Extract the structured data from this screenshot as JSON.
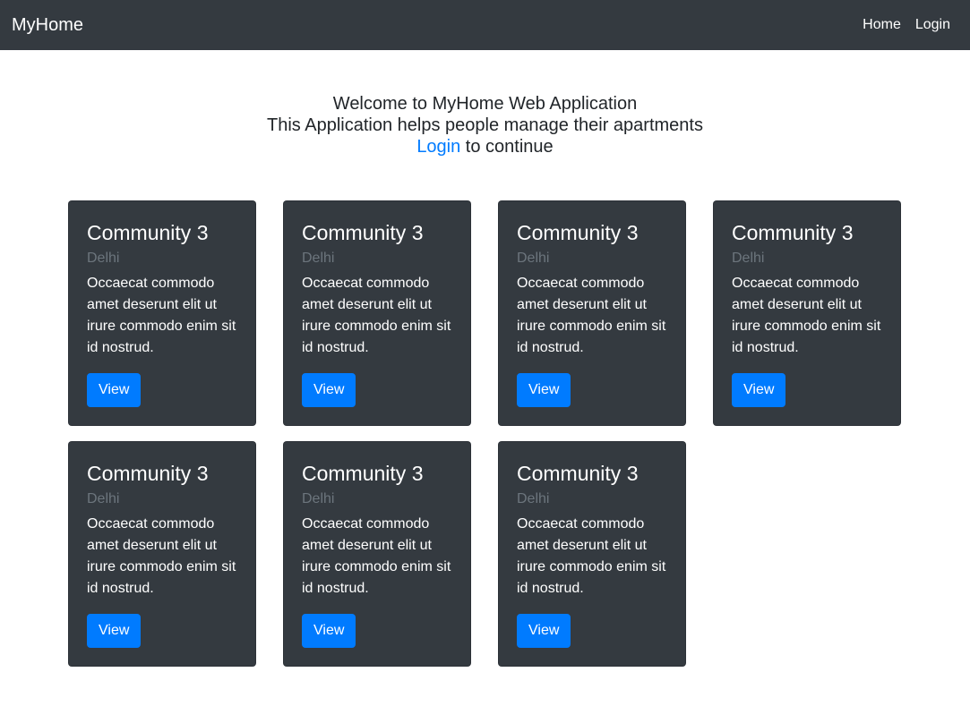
{
  "navbar": {
    "brand": "MyHome",
    "links": [
      {
        "label": "Home"
      },
      {
        "label": "Login"
      }
    ]
  },
  "welcome": {
    "line1": "Welcome to MyHome Web Application",
    "line2": "This Application helps people manage their apartments",
    "login_link": "Login",
    "line3_rest": " to continue"
  },
  "colors": {
    "navbar_bg": "#343a40",
    "card_bg": "#343a40",
    "accent": "#007bff",
    "muted": "#6c757d"
  },
  "cards": [
    {
      "title": "Community 3",
      "subtitle": "Delhi",
      "text": "Occaecat commodo amet deserunt elit ut irure commodo enim sit id nostrud.",
      "button": "View"
    },
    {
      "title": "Community 3",
      "subtitle": "Delhi",
      "text": "Occaecat commodo amet deserunt elit ut irure commodo enim sit id nostrud.",
      "button": "View"
    },
    {
      "title": "Community 3",
      "subtitle": "Delhi",
      "text": "Occaecat commodo amet deserunt elit ut irure commodo enim sit id nostrud.",
      "button": "View"
    },
    {
      "title": "Community 3",
      "subtitle": "Delhi",
      "text": "Occaecat commodo amet deserunt elit ut irure commodo enim sit id nostrud.",
      "button": "View"
    },
    {
      "title": "Community 3",
      "subtitle": "Delhi",
      "text": "Occaecat commodo amet deserunt elit ut irure commodo enim sit id nostrud.",
      "button": "View"
    },
    {
      "title": "Community 3",
      "subtitle": "Delhi",
      "text": "Occaecat commodo amet deserunt elit ut irure commodo enim sit id nostrud.",
      "button": "View"
    },
    {
      "title": "Community 3",
      "subtitle": "Delhi",
      "text": "Occaecat commodo amet deserunt elit ut irure commodo enim sit id nostrud.",
      "button": "View"
    }
  ]
}
